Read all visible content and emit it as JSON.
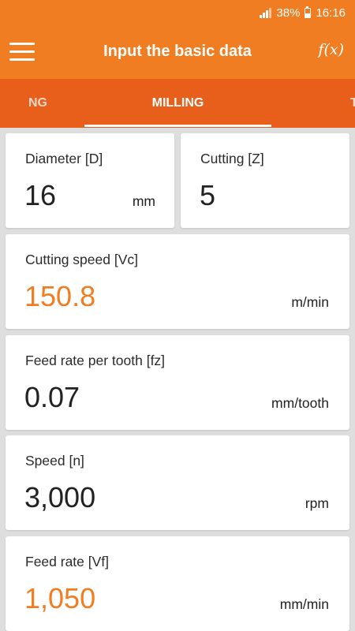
{
  "status_bar": {
    "battery_percent": "38%",
    "time": "16:16",
    "battery_level": 0.38
  },
  "app_bar": {
    "title": "Input the basic data",
    "fx_label": "f(x)"
  },
  "tabs": {
    "previous_partial": "NG",
    "active": "MILLING",
    "next_partial": "T"
  },
  "fields": {
    "diameter": {
      "label": "Diameter [D]",
      "value": "16",
      "unit": "mm"
    },
    "cutting": {
      "label": "Cutting [Z]",
      "value": "5"
    },
    "cutting_speed": {
      "label": "Cutting speed [Vc]",
      "value": "150.8",
      "unit": "m/min"
    },
    "feed_per_tooth": {
      "label": "Feed rate per tooth [fz]",
      "value": "0.07",
      "unit": "mm/tooth"
    },
    "speed": {
      "label": "Speed [n]",
      "value": "3,000",
      "unit": "rpm"
    },
    "feed_rate": {
      "label": "Feed rate [Vf]",
      "value": "1,050",
      "unit": "mm/min"
    }
  },
  "colors": {
    "accent": "#f07d22",
    "tab_bar": "#e85f1c",
    "background": "#dedede"
  }
}
